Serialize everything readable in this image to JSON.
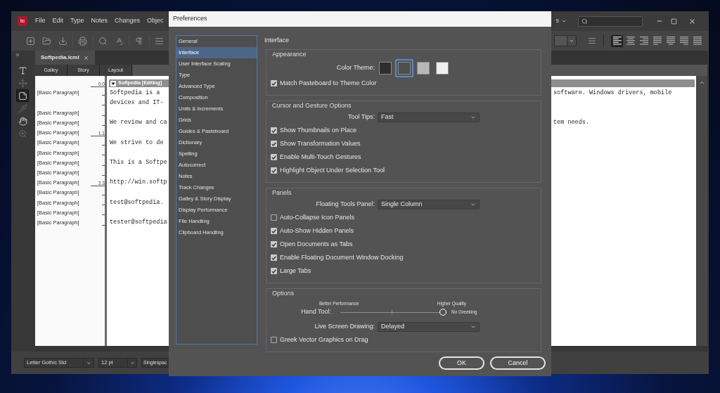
{
  "app": {
    "logo": "Ic",
    "menu": [
      "File",
      "Edit",
      "Type",
      "Notes",
      "Changes",
      "Objec"
    ],
    "workspace_menu": "s",
    "alignment_buttons": [
      {
        "kind": "left",
        "selected": true
      },
      {
        "kind": "center",
        "selected": false
      },
      {
        "kind": "right",
        "selected": false
      },
      {
        "kind": "justify_left",
        "selected": false
      },
      {
        "kind": "justify_center",
        "selected": false
      },
      {
        "kind": "justify_right",
        "selected": false
      },
      {
        "kind": "justify_all",
        "selected": false
      }
    ],
    "tools": [
      {
        "kind": "type",
        "selected": false,
        "disabled": false
      },
      {
        "kind": "position",
        "selected": false,
        "disabled": true
      },
      {
        "kind": "note",
        "selected": true,
        "disabled": false
      },
      {
        "kind": "eyedropper",
        "selected": false,
        "disabled": true
      },
      {
        "kind": "hand",
        "selected": false,
        "disabled": false
      },
      {
        "kind": "zoom",
        "selected": false,
        "disabled": true
      }
    ],
    "document_tab": "Softpedia.icml",
    "view_tabs": [
      "Galley",
      "Story",
      "Layout"
    ],
    "story": {
      "header_number": "0.0",
      "title": "Softpedia [Editing]",
      "rows": [
        {
          "style": "[Basic Paragraph]",
          "text": "Softpedia is a",
          "text_right": "software. Windows drivers, mobile"
        },
        {
          "text": "devices and IT-"
        },
        {
          "style": "[Basic Paragraph]"
        },
        {
          "style": "[Basic Paragraph]",
          "text": "We review and ca",
          "text_right": "tem needs."
        },
        {
          "style": "[Basic Paragraph]",
          "line_number": "1.1"
        },
        {
          "style": "[Basic Paragraph]",
          "text": "We strive to de"
        },
        {
          "style": "[Basic Paragraph]"
        },
        {
          "style": "[Basic Paragraph]",
          "text": "This is a Softpe"
        },
        {
          "style": "[Basic Paragraph]"
        },
        {
          "style": "[Basic Paragraph]",
          "line_number": "2.3",
          "text": "http://win.softp"
        },
        {
          "style": "[Basic Paragraph]"
        },
        {
          "style": "[Basic Paragraph]",
          "text": "test@softpedia."
        },
        {
          "style": "[Basic Paragraph]"
        },
        {
          "style": "[Basic Paragraph]",
          "text": "tester@softpedia"
        }
      ]
    },
    "status_bar": {
      "font": "Letter Gothic Std",
      "size": "12 pt",
      "spacing": "Singlespac"
    }
  },
  "dialog": {
    "title": "Preferences",
    "categories": [
      {
        "label": "General",
        "selected": false
      },
      {
        "label": "Interface",
        "selected": true
      },
      {
        "label": "User Interface Scaling",
        "selected": false
      },
      {
        "label": "Type",
        "selected": false
      },
      {
        "label": "Advanced Type",
        "selected": false
      },
      {
        "label": "Composition",
        "selected": false
      },
      {
        "label": "Units & Increments",
        "selected": false
      },
      {
        "label": "Grids",
        "selected": false
      },
      {
        "label": "Guides & Pasteboard",
        "selected": false
      },
      {
        "label": "Dictionary",
        "selected": false
      },
      {
        "label": "Spelling",
        "selected": false
      },
      {
        "label": "Autocorrect",
        "selected": false
      },
      {
        "label": "Notes",
        "selected": false
      },
      {
        "label": "Track Changes",
        "selected": false
      },
      {
        "label": "Galley & Story Display",
        "selected": false
      },
      {
        "label": "Display Performance",
        "selected": false
      },
      {
        "label": "File Handling",
        "selected": false
      },
      {
        "label": "Clipboard Handling",
        "selected": false
      }
    ],
    "heading": "Interface",
    "groups": [
      {
        "title": "Appearance",
        "items": [
          {
            "kind": "swatches",
            "label": "Color Theme:",
            "swatches": [
              {
                "color": "#2e2e2e",
                "selected": false
              },
              {
                "color": "#4e4e4e",
                "selected": true
              },
              {
                "color": "#b8b8b8",
                "selected": false
              },
              {
                "color": "#f0f0f0",
                "selected": false
              }
            ]
          },
          {
            "kind": "checkbox",
            "label": "Match Pasteboard to Theme Color",
            "checked": true
          }
        ]
      },
      {
        "title": "Cursor and Gesture Options",
        "items": [
          {
            "kind": "select",
            "label": "Tool Tips:",
            "value": "Fast"
          },
          {
            "kind": "checkbox",
            "label": "Show Thumbnails on Place",
            "checked": true
          },
          {
            "kind": "checkbox",
            "label": "Show Transformation Values",
            "checked": true
          },
          {
            "kind": "checkbox",
            "label": "Enable Multi-Touch Gestures",
            "checked": true
          },
          {
            "kind": "checkbox",
            "label": "Highlight Object Under Selection Tool",
            "checked": true
          }
        ]
      },
      {
        "title": "Panels",
        "items": [
          {
            "kind": "select",
            "label": "Floating Tools Panel:",
            "value": "Single Column"
          },
          {
            "kind": "checkbox",
            "label": "Auto-Collapse Icon Panels",
            "checked": false
          },
          {
            "kind": "checkbox",
            "label": "Auto-Show Hidden Panels",
            "checked": true
          },
          {
            "kind": "checkbox",
            "label": "Open Documents as Tabs",
            "checked": true
          },
          {
            "kind": "checkbox",
            "label": "Enable Floating Document Window Docking",
            "checked": true
          },
          {
            "kind": "checkbox",
            "label": "Large Tabs",
            "checked": true
          }
        ]
      },
      {
        "title": "Options",
        "items": [
          {
            "kind": "slider",
            "label": "Hand Tool:",
            "min_label": "Better Performance",
            "max_label": "Higher Quality",
            "level": 1,
            "reading": "No Greeking"
          },
          {
            "kind": "select",
            "label": "Live Screen Drawing:",
            "value": "Delayed"
          },
          {
            "kind": "checkbox",
            "label": "Greek Vector Graphics on Drag",
            "checked": false
          }
        ]
      }
    ],
    "buttons": [
      "OK",
      "Cancel"
    ]
  }
}
